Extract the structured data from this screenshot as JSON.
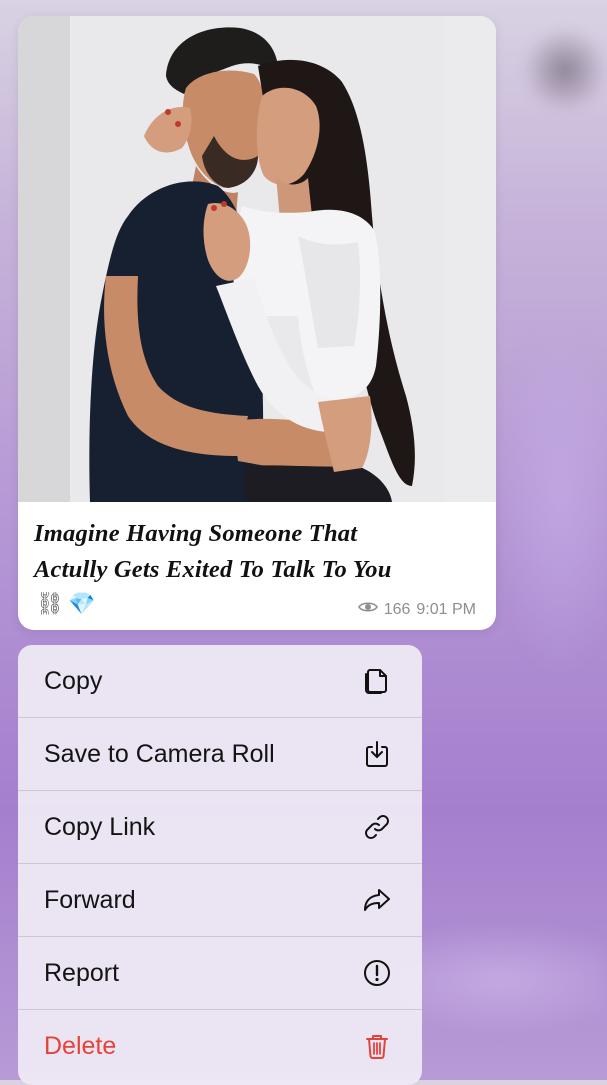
{
  "message": {
    "caption_lines": [
      "Imagine Having Someone That",
      "Actully Gets Exited To Talk To You"
    ],
    "emojis": [
      "⛓",
      "💎"
    ],
    "views": "166",
    "time": "9:01 PM"
  },
  "context_menu": {
    "items": [
      {
        "label": "Copy",
        "icon": "copy-icon"
      },
      {
        "label": "Save to Camera Roll",
        "icon": "save-download-icon"
      },
      {
        "label": "Copy Link",
        "icon": "link-icon"
      },
      {
        "label": "Forward",
        "icon": "forward-arrow-icon"
      },
      {
        "label": "Report",
        "icon": "report-exclamation-icon"
      },
      {
        "label": "Delete",
        "icon": "trash-icon",
        "color": "#e5433a"
      }
    ]
  },
  "colors": {
    "danger": "#e5433a",
    "meta_gray": "#8e8e93",
    "background_purple": "#a57fce"
  }
}
